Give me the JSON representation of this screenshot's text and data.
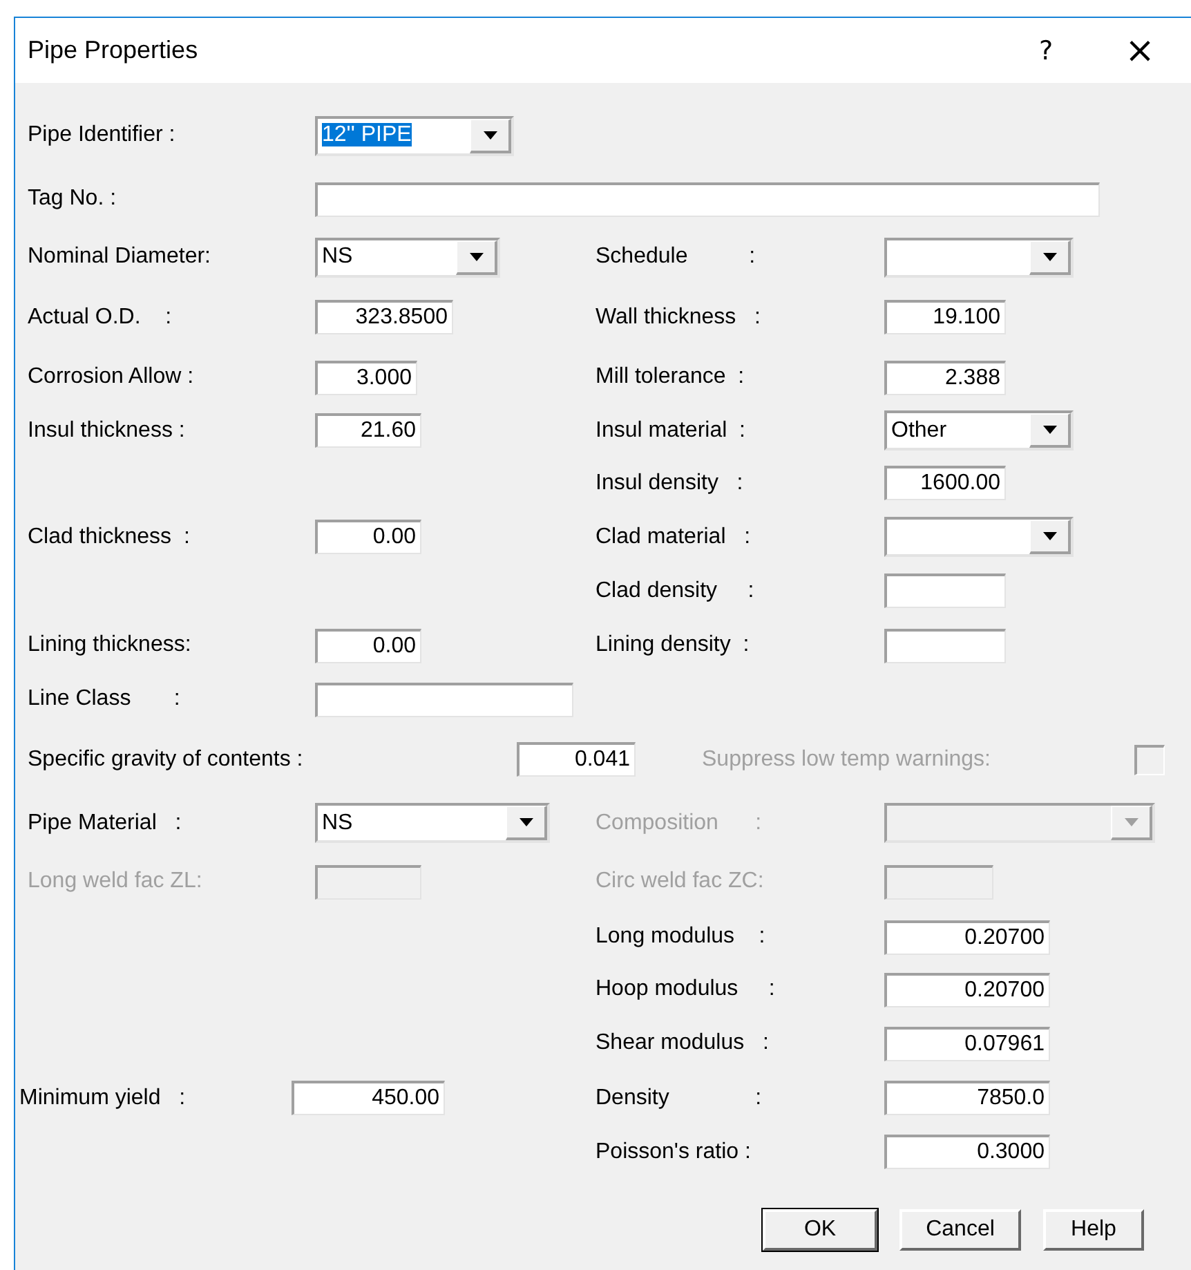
{
  "window": {
    "title": "Pipe Properties",
    "help": "?",
    "close": "×"
  },
  "rows": [
    {
      "kind": "pair",
      "left": {
        "label": "Pipe Identifier :",
        "kind": "combo",
        "value": "12'' PIPE",
        "highlighted": true,
        "disabled": false
      }
    },
    {
      "kind": "pair",
      "left": {
        "label": "Tag No. :",
        "kind": "text",
        "disabled": false
      }
    },
    {
      "kind": "pair",
      "left": {
        "label": "Nominal Diameter:",
        "kind": "combo",
        "value": "NS",
        "disabled": false
      },
      "right": {
        "label": "Schedule          :",
        "kind": "combo",
        "disabled": false
      }
    },
    {
      "kind": "pair",
      "left": {
        "label": "Actual O.D.    :",
        "kind": "text",
        "value": "323.8500",
        "disabled": false
      },
      "right": {
        "label": "Wall thickness   :",
        "kind": "text",
        "value": "19.100",
        "disabled": false
      }
    },
    {
      "kind": "pair",
      "left": {
        "label": "Corrosion Allow :",
        "kind": "text",
        "value": "3.000",
        "disabled": false
      },
      "right": {
        "label": "Mill tolerance  :",
        "kind": "text",
        "value": "2.388",
        "disabled": false
      }
    },
    {
      "kind": "pair",
      "left": {
        "label": "Insul thickness :",
        "kind": "text",
        "value": "21.60",
        "disabled": false
      },
      "right": {
        "label": "Insul material  :",
        "kind": "combo",
        "value": "Other",
        "disabled": false
      }
    },
    {
      "kind": "pair",
      "right": {
        "label": "Insul density   :",
        "kind": "text",
        "value": "1600.00",
        "disabled": false
      }
    },
    {
      "kind": "pair",
      "left": {
        "label": "Clad thickness  :",
        "kind": "text",
        "value": "0.00",
        "disabled": false
      },
      "right": {
        "label": "Clad material   :",
        "kind": "combo",
        "disabled": false
      }
    },
    {
      "kind": "pair",
      "right": {
        "label": "Clad density     :",
        "kind": "text",
        "disabled": false
      }
    },
    {
      "kind": "pair",
      "left": {
        "label": "Lining thickness:",
        "kind": "text",
        "value": "0.00",
        "disabled": false
      },
      "right": {
        "label": "Lining density  :",
        "kind": "text",
        "disabled": false
      }
    },
    {
      "kind": "pair",
      "left": {
        "label": "Line Class       :",
        "kind": "text",
        "disabled": false
      }
    },
    {
      "kind": "wide",
      "left": {
        "label": "Specific gravity of contents :",
        "kind": "text",
        "value": "0.041",
        "disabled": false
      },
      "right": {
        "label": "Suppress low temp warnings:",
        "kind": "check",
        "checked": false,
        "disabled": true
      }
    },
    {
      "kind": "pair",
      "left": {
        "label": "Pipe Material   :",
        "kind": "combo",
        "value": "NS",
        "disabled": false
      },
      "right": {
        "label": "Composition      :",
        "kind": "combo",
        "disabled": true
      }
    },
    {
      "kind": "pair",
      "left": {
        "label": "Long weld fac ZL:",
        "kind": "text",
        "disabled": true
      },
      "right": {
        "label": "Circ weld fac ZC:",
        "kind": "text",
        "disabled": true
      }
    },
    {
      "kind": "pair",
      "right": {
        "label": "Long modulus    :",
        "kind": "text",
        "value": "0.20700",
        "disabled": false
      }
    },
    {
      "kind": "pair",
      "right": {
        "label": "Hoop modulus     :",
        "kind": "text",
        "value": "0.20700",
        "disabled": false
      }
    },
    {
      "kind": "pair",
      "right": {
        "label": "Shear modulus   :",
        "kind": "text",
        "value": "0.07961",
        "disabled": false
      }
    },
    {
      "kind": "pair",
      "left": {
        "label": "Minimum yield   :",
        "kind": "text",
        "value": "450.00",
        "disabled": false
      },
      "right": {
        "label": "Density              :",
        "kind": "text",
        "value": "7850.0",
        "disabled": false
      }
    },
    {
      "kind": "pair",
      "right": {
        "label": "Poisson's ratio :",
        "kind": "text",
        "value": "0.3000",
        "disabled": false
      }
    }
  ],
  "buttons": [
    "OK",
    "Cancel",
    "Help"
  ]
}
